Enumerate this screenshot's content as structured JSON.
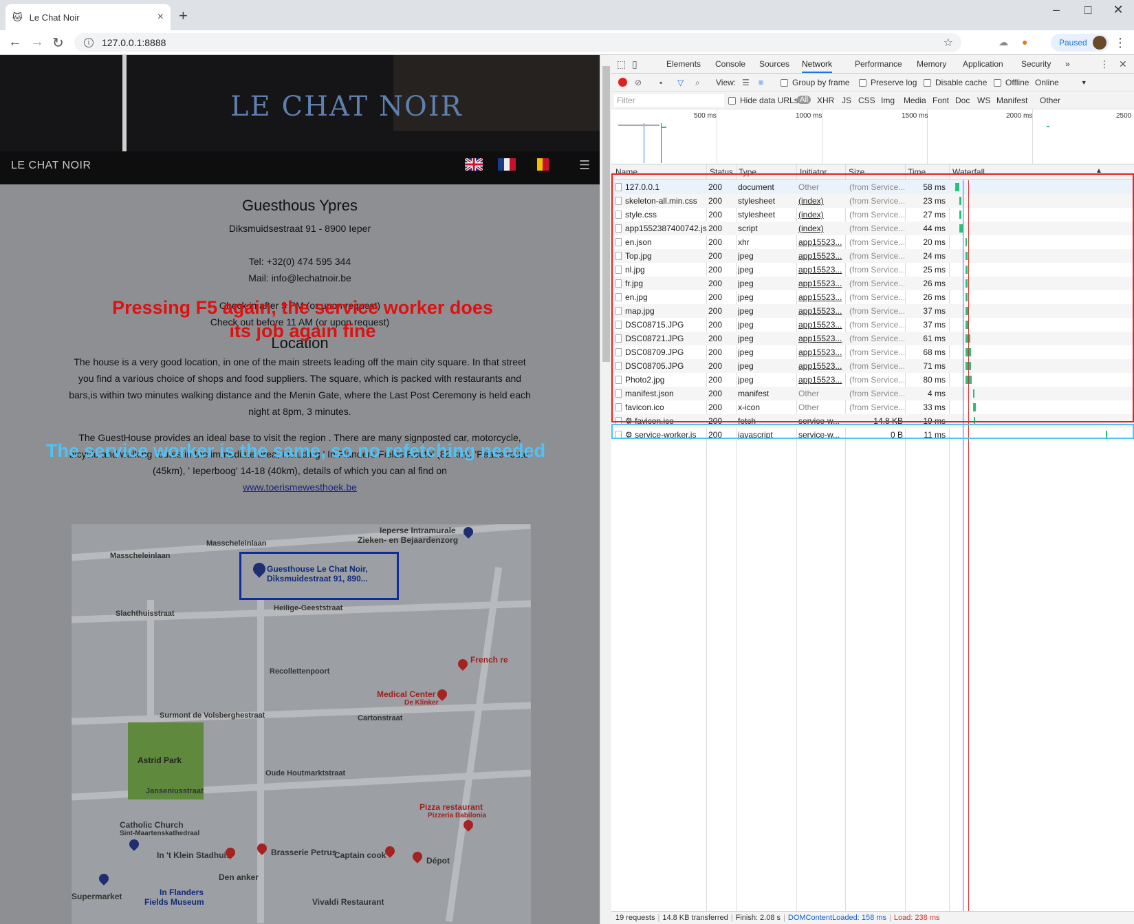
{
  "browser": {
    "tab_title": "Le Chat Noir",
    "url": "127.0.0.1:8888",
    "profile_status": "Paused"
  },
  "page": {
    "logo_text": "LE CHAT NOIR",
    "nav_brand": "LE CHAT NOIR",
    "heading": "Guesthous Ypres",
    "address": "Diksmuidsestraat 91 - 8900 Ieper",
    "tel": "Tel: +32(0) 474 595 344",
    "mail": "Mail: info@lechatnoir.be",
    "checkin": "Check in after 3 PM (or upon request)",
    "checkout": "Check out before 11 AM (or upon request)",
    "location_heading": "Location",
    "location_text": "The house is a very good location, in one of the main streets leading off the main city square. In that street you find a various choice of shops and food suppliers. The square, which is packed with restaurants and bars,is within two minutes walking distance and the Menin Gate, where the Last Post Ceremony is held each night at 8pm, 3 minutes.",
    "guesthouse_text": "The GuestHouse provides an ideal base to visit the region . There are many signposted car, motorcycle, bicycle and walking routes in the immediate area, including ' In Flanders Fields Route' (82 km), 'Peace route' (45km), ' Ieperboog' 14-18 (40km), details of which you can al find on",
    "link": "www.toerismewesthoek.be"
  },
  "annotations": {
    "red_line1": "Pressing F5 again, the service worker does",
    "red_line2": "its job again fine",
    "blue": "The service worker is the same, so no refetching needed"
  },
  "map": {
    "labels": {
      "masscheleinlaan1": "Masscheleinlaan",
      "masscheleinlaan2": "Masscheleinlaan",
      "ieperse": "Ieperse Intramurale",
      "zieken": "Zieken- en Bejaardenzorg",
      "marker": "Guesthouse Le Chat Noir,",
      "marker2": "Diksmuidestraat 91, 890...",
      "slachthuis": "Slachthuisstraat",
      "heilige": "Heilige-Geeststraat",
      "recollet": "Recollettenpoort",
      "french": "French re",
      "medical": "Medical Center",
      "klinker": "De Klinker",
      "surmont": "Surmont de Volsberghestraat",
      "carton": "Cartonstraat",
      "astrid": "Astrid Park",
      "houtmarkt": "Oude Houtmarktstraat",
      "jansenius": "Janseniusstraat",
      "church": "Catholic Church",
      "church2": "Sint-Maartenskathedraal",
      "pizza": "Pizza restaurant",
      "pizza2": "Pizzeria Babilonia",
      "klein": "In 't Klein Stadhuis",
      "brasserie": "Brasserie Petrus",
      "captain": "Captain cook",
      "depot": "Dépot",
      "anker": "Den anker",
      "supermarket": "Supermarket",
      "museum": "In Flanders",
      "museum2": "Fields Museum",
      "vivaldi": "Vivaldi Restaurant"
    }
  },
  "devtools": {
    "tabs": [
      "Elements",
      "Console",
      "Sources",
      "Network",
      "Performance",
      "Memory",
      "Application",
      "Security"
    ],
    "more": "»",
    "view_label": "View:",
    "group_by_frame": "Group by frame",
    "preserve_log": "Preserve log",
    "disable_cache": "Disable cache",
    "offline": "Offline",
    "throttle": "Online",
    "filter_placeholder": "Filter",
    "hide_data_urls": "Hide data URLs",
    "filter_types": [
      "All",
      "XHR",
      "JS",
      "CSS",
      "Img",
      "Media",
      "Font",
      "Doc",
      "WS",
      "Manifest",
      "Other"
    ],
    "timeline_labels": [
      "500 ms",
      "1000 ms",
      "1500 ms",
      "2000 ms",
      "2500"
    ],
    "columns": [
      "Name",
      "Status",
      "Type",
      "Initiator",
      "Size",
      "Time",
      "Waterfall"
    ],
    "requests": [
      {
        "name": "127.0.0.1",
        "status": "200",
        "type": "document",
        "initiator": "Other",
        "size": "(from Service...",
        "time": "58 ms",
        "start": 0,
        "dur": 58
      },
      {
        "name": "skeleton-all.min.css",
        "status": "200",
        "type": "stylesheet",
        "initiator": "(index)",
        "size": "(from Service...",
        "time": "23 ms",
        "start": 58,
        "dur": 23
      },
      {
        "name": "style.css",
        "status": "200",
        "type": "stylesheet",
        "initiator": "(index)",
        "size": "(from Service...",
        "time": "27 ms",
        "start": 58,
        "dur": 27
      },
      {
        "name": "app1552387400742.js",
        "status": "200",
        "type": "script",
        "initiator": "(index)",
        "size": "(from Service...",
        "time": "44 ms",
        "start": 58,
        "dur": 44
      },
      {
        "name": "en.json",
        "status": "200",
        "type": "xhr",
        "initiator": "app15523...",
        "size": "(from Service...",
        "time": "20 ms",
        "start": 138,
        "dur": 20
      },
      {
        "name": "Top.jpg",
        "status": "200",
        "type": "jpeg",
        "initiator": "app15523...",
        "size": "(from Service...",
        "time": "24 ms",
        "start": 138,
        "dur": 24
      },
      {
        "name": "nl.jpg",
        "status": "200",
        "type": "jpeg",
        "initiator": "app15523...",
        "size": "(from Service...",
        "time": "25 ms",
        "start": 138,
        "dur": 25
      },
      {
        "name": "fr.jpg",
        "status": "200",
        "type": "jpeg",
        "initiator": "app15523...",
        "size": "(from Service...",
        "time": "26 ms",
        "start": 138,
        "dur": 26
      },
      {
        "name": "en.jpg",
        "status": "200",
        "type": "jpeg",
        "initiator": "app15523...",
        "size": "(from Service...",
        "time": "26 ms",
        "start": 138,
        "dur": 26
      },
      {
        "name": "map.jpg",
        "status": "200",
        "type": "jpeg",
        "initiator": "app15523...",
        "size": "(from Service...",
        "time": "37 ms",
        "start": 138,
        "dur": 37
      },
      {
        "name": "DSC08715.JPG",
        "status": "200",
        "type": "jpeg",
        "initiator": "app15523...",
        "size": "(from Service...",
        "time": "37 ms",
        "start": 138,
        "dur": 37
      },
      {
        "name": "DSC08721.JPG",
        "status": "200",
        "type": "jpeg",
        "initiator": "app15523...",
        "size": "(from Service...",
        "time": "61 ms",
        "start": 138,
        "dur": 61
      },
      {
        "name": "DSC08709.JPG",
        "status": "200",
        "type": "jpeg",
        "initiator": "app15523...",
        "size": "(from Service...",
        "time": "68 ms",
        "start": 138,
        "dur": 68
      },
      {
        "name": "DSC08705.JPG",
        "status": "200",
        "type": "jpeg",
        "initiator": "app15523...",
        "size": "(from Service...",
        "time": "71 ms",
        "start": 138,
        "dur": 71
      },
      {
        "name": "Photo2.jpg",
        "status": "200",
        "type": "jpeg",
        "initiator": "app15523...",
        "size": "(from Service...",
        "time": "80 ms",
        "start": 138,
        "dur": 80
      },
      {
        "name": "manifest.json",
        "status": "200",
        "type": "manifest",
        "initiator": "Other",
        "size": "(from Service...",
        "time": "4 ms",
        "start": 238,
        "dur": 4
      },
      {
        "name": "favicon.ico",
        "status": "200",
        "type": "x-icon",
        "initiator": "Other",
        "size": "(from Service...",
        "time": "33 ms",
        "start": 238,
        "dur": 33
      },
      {
        "name": "⚙ favicon.ico",
        "status": "200",
        "type": "fetch",
        "initiator": "service-w...",
        "size": "14.8 KB",
        "time": "19 ms",
        "start": 248,
        "dur": 19
      },
      {
        "name": "⚙ service-worker.js",
        "status": "200",
        "type": "javascript",
        "initiator": "service-w...",
        "size": "0 B",
        "time": "11 ms",
        "start": 2070,
        "dur": 11
      }
    ],
    "status_bar": {
      "requests": "19 requests",
      "transferred": "14.8 KB transferred",
      "finish": "Finish: 2.08 s",
      "dcl": "DOMContentLoaded: 158 ms",
      "load": "Load: 238 ms"
    }
  }
}
